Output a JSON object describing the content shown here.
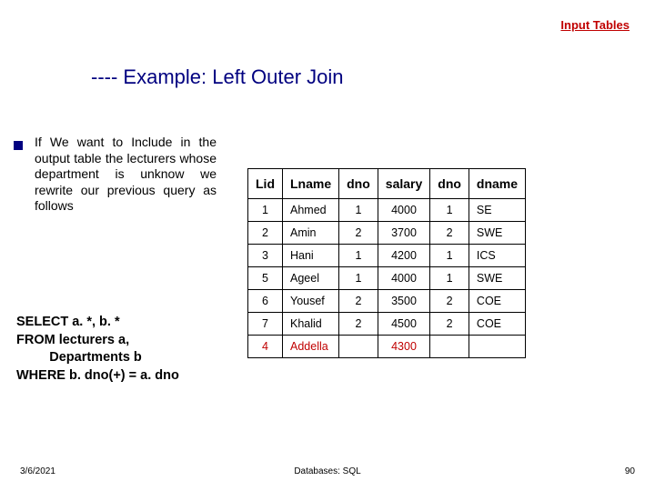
{
  "top_link": "Input Tables",
  "title": "---- Example: Left Outer Join",
  "body_text": "If We want to Include in the output table the lecturers whose department is unknow we rewrite our previous query as follows",
  "sql": {
    "l1": "SELECT a. *, b. *",
    "l2": "FROM lecturers a,",
    "l3": "         Departments b",
    "l4": "WHERE b. dno(+) = a. dno"
  },
  "table": {
    "headers": [
      "Lid",
      "Lname",
      "dno",
      "salary",
      "dno",
      "dname"
    ],
    "rows": [
      {
        "lid": "1",
        "lname": "Ahmed",
        "dno1": "1",
        "salary": "4000",
        "dno2": "1",
        "dname": "SE",
        "hl": false
      },
      {
        "lid": "2",
        "lname": "Amin",
        "dno1": "2",
        "salary": "3700",
        "dno2": "2",
        "dname": "SWE",
        "hl": false
      },
      {
        "lid": "3",
        "lname": "Hani",
        "dno1": "1",
        "salary": "4200",
        "dno2": "1",
        "dname": "ICS",
        "hl": false
      },
      {
        "lid": "5",
        "lname": "Ageel",
        "dno1": "1",
        "salary": "4000",
        "dno2": "1",
        "dname": "SWE",
        "hl": false
      },
      {
        "lid": "6",
        "lname": "Yousef",
        "dno1": "2",
        "salary": "3500",
        "dno2": "2",
        "dname": "COE",
        "hl": false
      },
      {
        "lid": "7",
        "lname": "Khalid",
        "dno1": "2",
        "salary": "4500",
        "dno2": "2",
        "dname": "COE",
        "hl": false
      },
      {
        "lid": "4",
        "lname": "Addella",
        "dno1": "",
        "salary": "4300",
        "dno2": "",
        "dname": "",
        "hl": true
      }
    ]
  },
  "footer": {
    "date": "3/6/2021",
    "center": "Databases: SQL",
    "pageno": "90"
  }
}
